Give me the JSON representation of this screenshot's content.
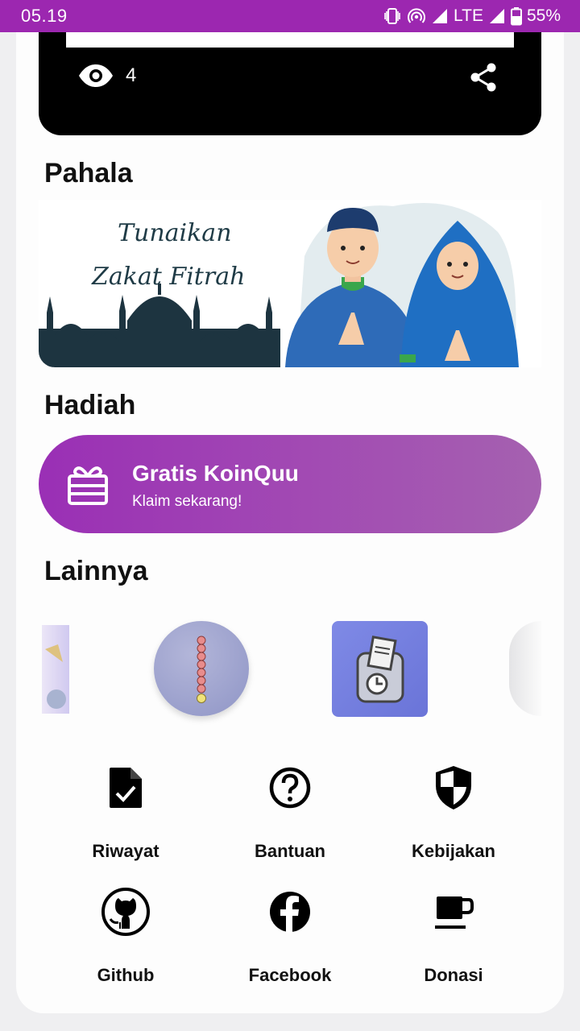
{
  "status": {
    "time": "05.19",
    "network": "LTE",
    "battery": "55%"
  },
  "video": {
    "views": "4"
  },
  "sections": {
    "pahala": "Pahala",
    "hadiah": "Hadiah",
    "lainnya": "Lainnya"
  },
  "banner": {
    "line1": "Tunaikan",
    "line2": "Zakat Fitrah"
  },
  "reward": {
    "title": "Gratis KoinQuu",
    "subtitle": "Klaim sekarang!"
  },
  "menu": [
    {
      "label": "Riwayat",
      "icon": "file-check-icon"
    },
    {
      "label": "Bantuan",
      "icon": "help-circle-icon"
    },
    {
      "label": "Kebijakan",
      "icon": "shield-icon"
    },
    {
      "label": "Github",
      "icon": "github-icon"
    },
    {
      "label": "Facebook",
      "icon": "facebook-icon"
    },
    {
      "label": "Donasi",
      "icon": "coffee-cup-icon"
    }
  ],
  "colors": {
    "status_bar": "#9c27b0",
    "reward_start": "#9a2fb5",
    "reward_end": "#a561b0"
  }
}
